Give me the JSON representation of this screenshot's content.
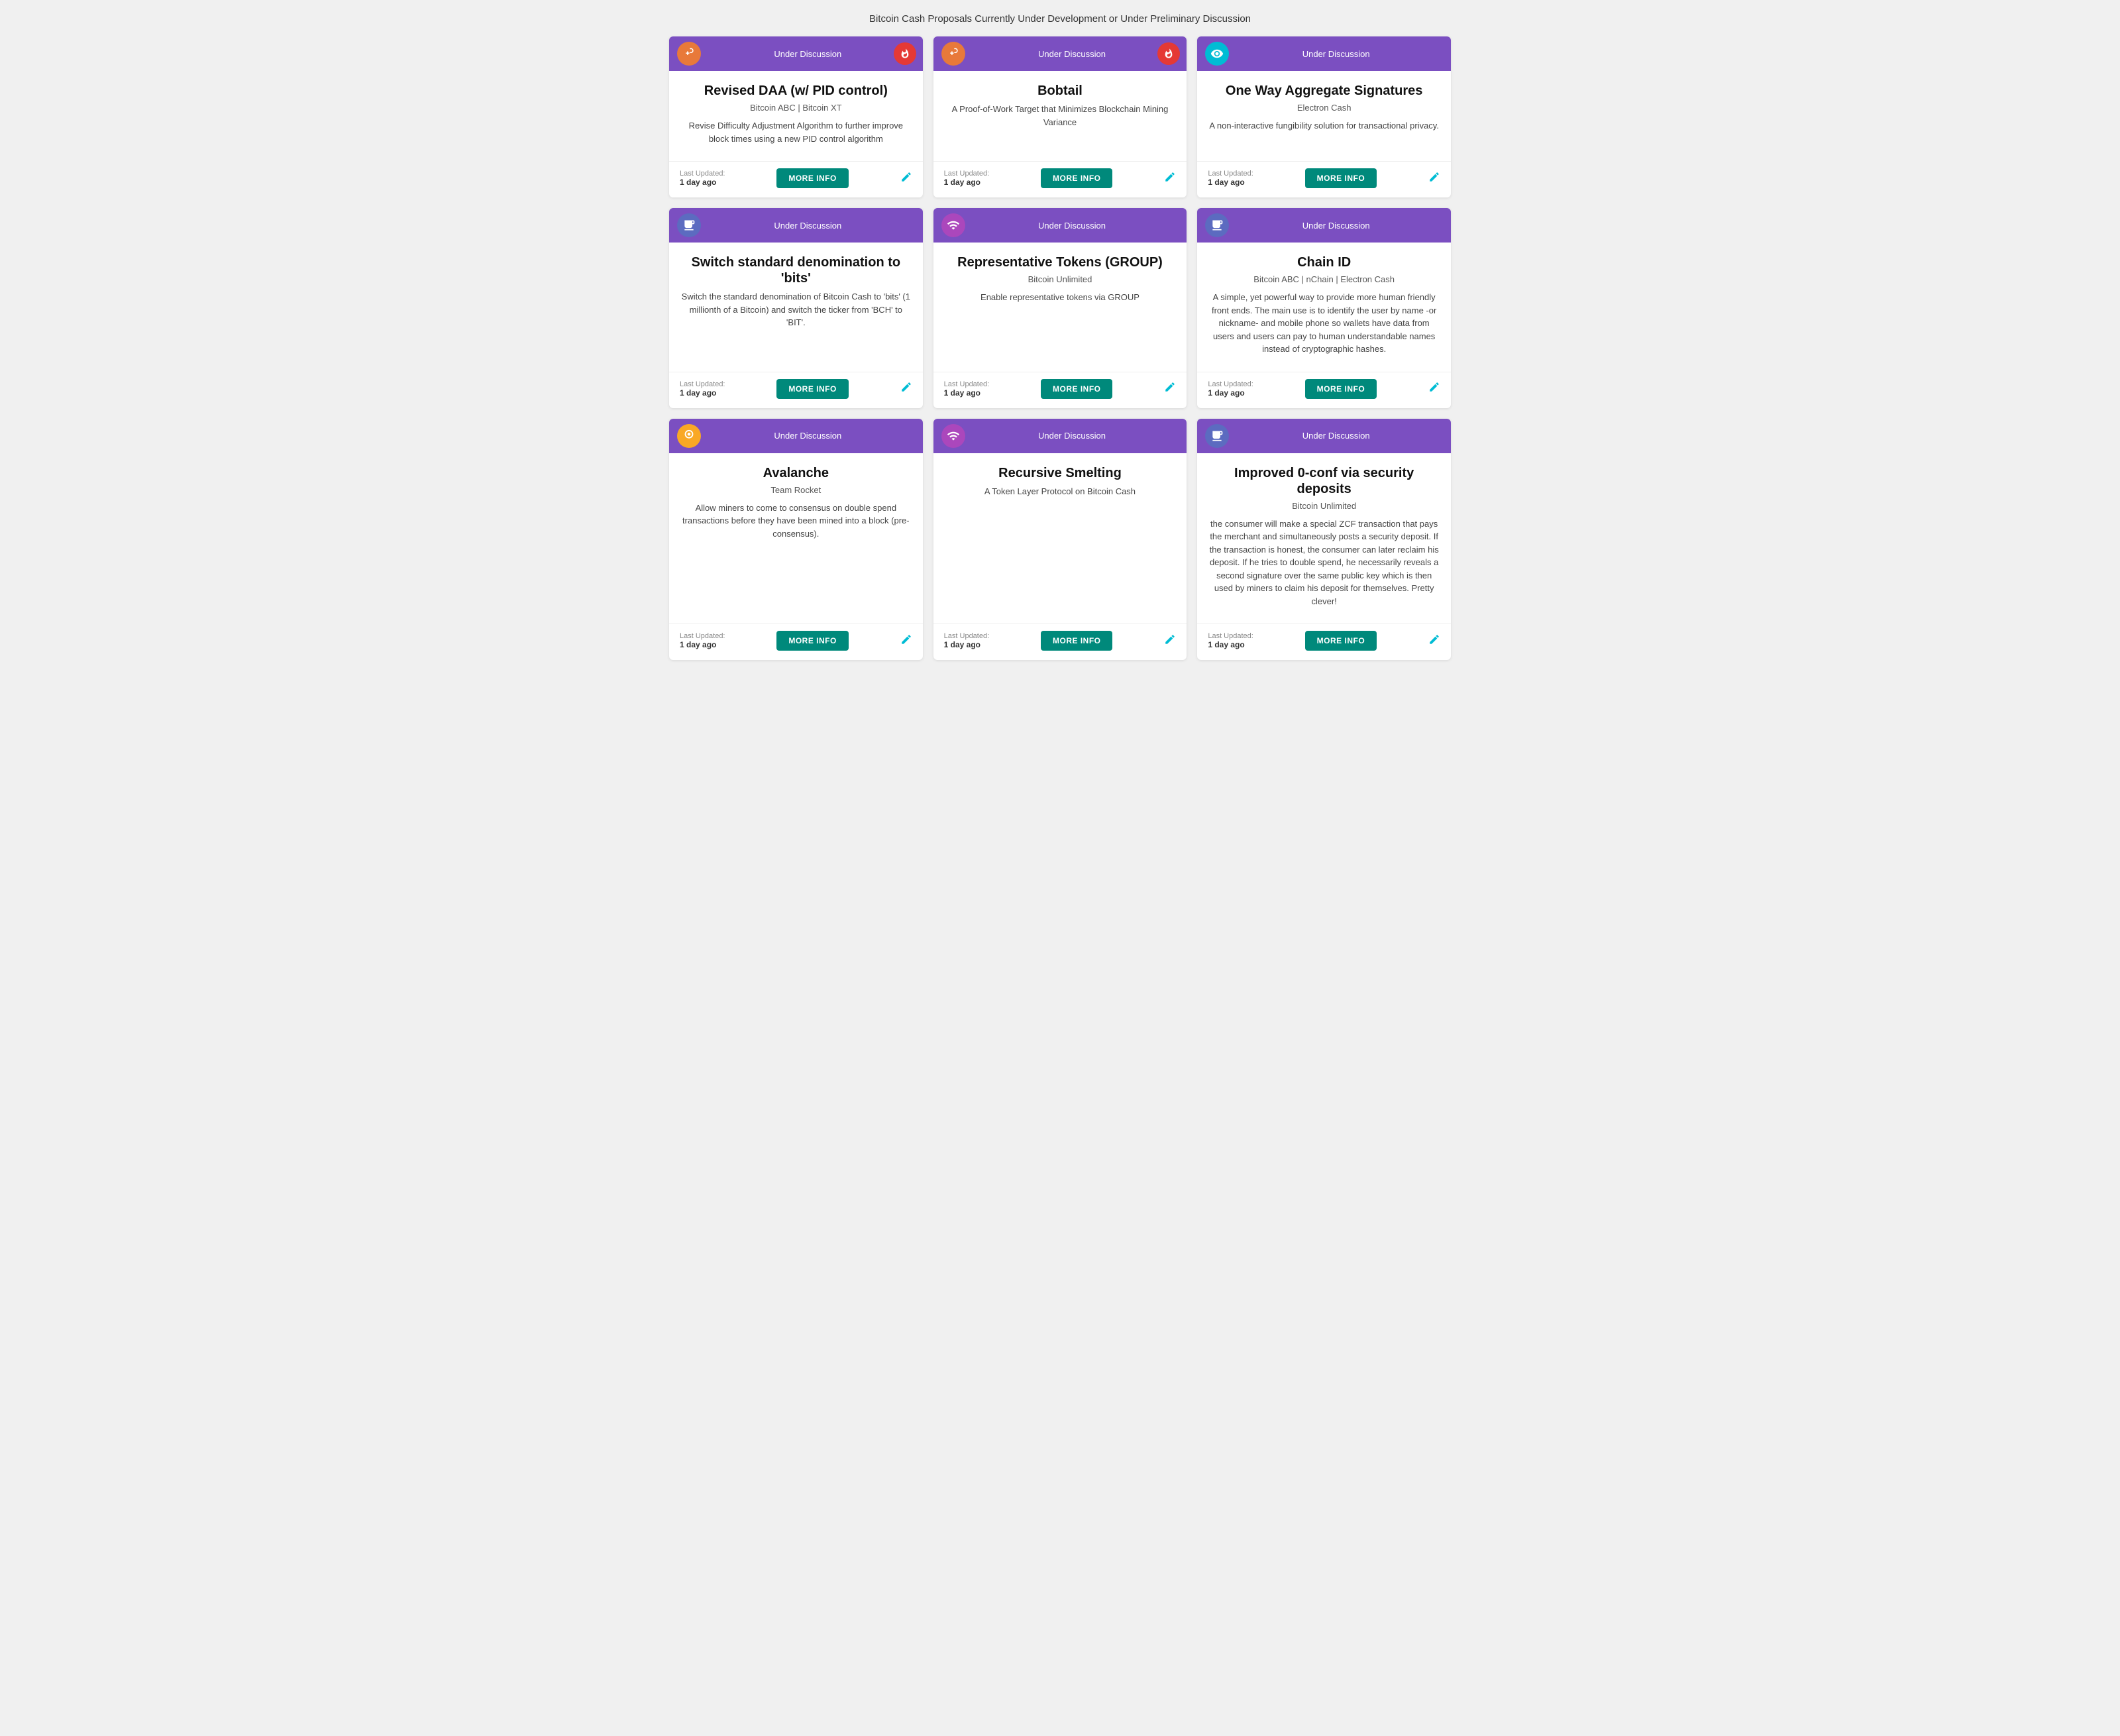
{
  "page": {
    "title": "Bitcoin Cash Proposals Currently Under Development or Under Preliminary Discussion"
  },
  "cards": [
    {
      "id": "revised-daa",
      "status": "Under Discussion",
      "icon": "🔧",
      "icon_color": "icon-orange",
      "right_icon": "🔥",
      "right_icon_color": "fire-icon",
      "title": "Revised DAA (w/ PID control)",
      "subtitle": "Bitcoin ABC | Bitcoin XT",
      "description": "Revise Difficulty Adjustment Algorithm to further improve block times using a new PID control algorithm",
      "last_updated_label": "Last Updated:",
      "last_updated_value": "1 day ago",
      "more_info_label": "MORE INFO"
    },
    {
      "id": "bobtail",
      "status": "Under Discussion",
      "icon": "🔧",
      "icon_color": "icon-orange",
      "right_icon": "🔥",
      "right_icon_color": "fire-icon",
      "title": "Bobtail",
      "subtitle": "",
      "description": "A Proof-of-Work Target that Minimizes Blockchain Mining Variance",
      "last_updated_label": "Last Updated:",
      "last_updated_value": "1 day ago",
      "more_info_label": "MORE INFO"
    },
    {
      "id": "one-way-aggregate",
      "status": "Under Discussion",
      "icon": "👁",
      "icon_color": "icon-teal",
      "right_icon": "",
      "right_icon_color": "",
      "title": "One Way Aggregate Signatures",
      "subtitle": "Electron Cash",
      "description": "A non-interactive fungibility solution for transactional privacy.",
      "last_updated_label": "Last Updated:",
      "last_updated_value": "1 day ago",
      "more_info_label": "MORE INFO"
    },
    {
      "id": "switch-denomination",
      "status": "Under Discussion",
      "icon": "☕",
      "icon_color": "icon-blue",
      "right_icon": "",
      "right_icon_color": "",
      "title": "Switch standard denomination to 'bits'",
      "subtitle": "",
      "description": "Switch the standard denomination of Bitcoin Cash to 'bits' (1 millionth of a Bitcoin) and switch the ticker from 'BCH' to 'BIT'.",
      "last_updated_label": "Last Updated:",
      "last_updated_value": "1 day ago",
      "more_info_label": "MORE INFO"
    },
    {
      "id": "representative-tokens",
      "status": "Under Discussion",
      "icon": "📡",
      "icon_color": "icon-purple",
      "right_icon": "",
      "right_icon_color": "",
      "title": "Representative Tokens (GROUP)",
      "subtitle": "Bitcoin Unlimited",
      "description": "Enable representative tokens via GROUP",
      "last_updated_label": "Last Updated:",
      "last_updated_value": "1 day ago",
      "more_info_label": "MORE INFO"
    },
    {
      "id": "chain-id",
      "status": "Under Discussion",
      "icon": "☕",
      "icon_color": "icon-blue",
      "right_icon": "",
      "right_icon_color": "",
      "title": "Chain ID",
      "subtitle": "Bitcoin ABC | nChain | Electron Cash",
      "description": "A simple, yet powerful way to provide more human friendly front ends. The main use is to identify the user by name -or nickname- and mobile phone so wallets have data from users and users can pay to human understandable names instead of cryptographic hashes.",
      "last_updated_label": "Last Updated:",
      "last_updated_value": "1 day ago",
      "more_info_label": "MORE INFO"
    },
    {
      "id": "avalanche",
      "status": "Under Discussion",
      "icon": "🔵",
      "icon_color": "icon-yellow",
      "title": "Avalanche",
      "subtitle": "Team Rocket",
      "description": "Allow miners to come to consensus on double spend transactions before they have been mined into a block (pre-consensus).",
      "last_updated_label": "Last Updated:",
      "last_updated_value": "1 day ago",
      "more_info_label": "MORE INFO"
    },
    {
      "id": "recursive-smelting",
      "status": "Under Discussion",
      "icon": "📡",
      "icon_color": "icon-purple",
      "title": "Recursive Smelting",
      "subtitle": "",
      "description": "A Token Layer Protocol on Bitcoin Cash",
      "last_updated_label": "Last Updated:",
      "last_updated_value": "1 day ago",
      "more_info_label": "MORE INFO"
    },
    {
      "id": "improved-0conf",
      "status": "Under Discussion",
      "icon": "☕",
      "icon_color": "icon-blue",
      "title": "Improved 0-conf via security deposits",
      "subtitle": "Bitcoin Unlimited",
      "description": "the consumer will make a special ZCF transaction that pays the merchant and simultaneously posts a security deposit. If the transaction is honest, the consumer can later reclaim his deposit. If he tries to double spend, he necessarily reveals a second signature over the same public key which is then used by miners to claim his deposit for themselves. Pretty clever!",
      "last_updated_label": "Last Updated:",
      "last_updated_value": "1 day ago",
      "more_info_label": "MORE INFO"
    }
  ]
}
